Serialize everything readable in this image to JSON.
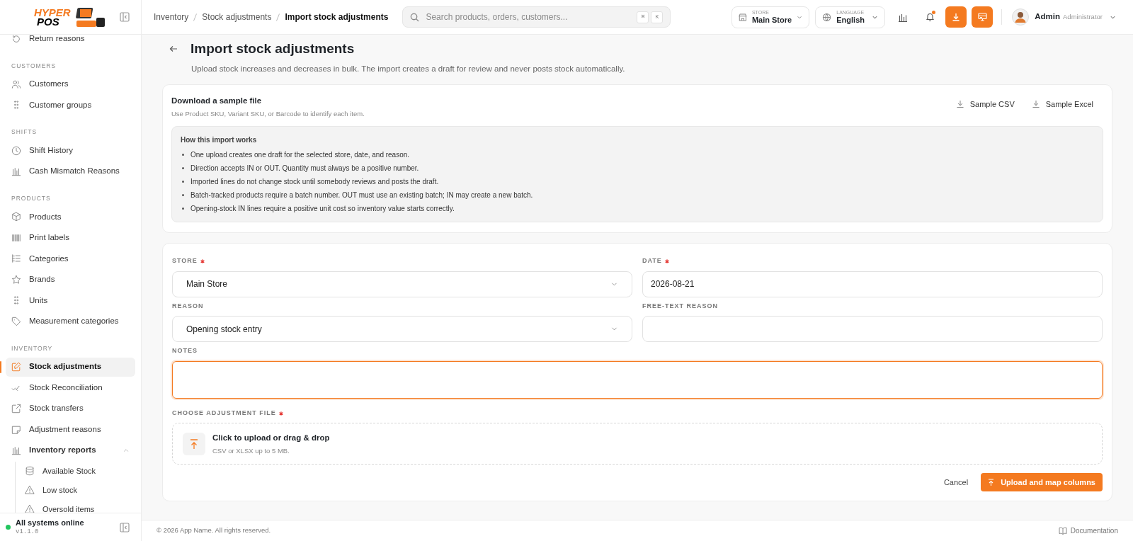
{
  "logo": {
    "line_1": "HYPER",
    "line_2": "POS"
  },
  "breadcrumbs": [
    {
      "label": "Inventory",
      "current": false
    },
    {
      "label": "Stock adjustments",
      "current": false
    },
    {
      "label": "Import stock adjustments",
      "current": true
    }
  ],
  "search": {
    "placeholder": "Search products, orders, customers...",
    "shortcut_keys": [
      "⌘",
      "K"
    ]
  },
  "store_picker": {
    "label": "STORE",
    "value": "Main Store"
  },
  "language_picker": {
    "label": "LANGUAGE",
    "value": "English"
  },
  "notifications": {
    "unread": true
  },
  "user": {
    "name": "Admin",
    "role": "Administrator"
  },
  "sidebar": {
    "sections": [
      {
        "items": [
          {
            "label": "Return reasons",
            "selected": false
          }
        ]
      },
      {
        "heading": "CUSTOMERS",
        "items": [
          {
            "label": "Customers",
            "selected": false
          },
          {
            "label": "Customer groups",
            "selected": false
          }
        ]
      },
      {
        "heading": "SHIFTS",
        "items": [
          {
            "label": "Shift History",
            "selected": false
          },
          {
            "label": "Cash Mismatch Reasons",
            "selected": false
          }
        ]
      },
      {
        "heading": "PRODUCTS",
        "items": [
          {
            "label": "Products",
            "selected": false
          },
          {
            "label": "Print labels",
            "selected": false
          },
          {
            "label": "Categories",
            "selected": false
          },
          {
            "label": "Brands",
            "selected": false
          },
          {
            "label": "Units",
            "selected": false
          },
          {
            "label": "Measurement categories",
            "selected": false
          }
        ]
      },
      {
        "heading": "INVENTORY",
        "items": [
          {
            "label": "Stock adjustments",
            "selected": true
          },
          {
            "label": "Stock Reconciliation",
            "selected": false
          },
          {
            "label": "Stock transfers",
            "selected": false
          },
          {
            "label": "Adjustment reasons",
            "selected": false
          },
          {
            "label": "Inventory reports",
            "selected": false,
            "expanded": true,
            "children": [
              {
                "label": "Available Stock",
                "selected": false
              },
              {
                "label": "Low stock",
                "selected": false
              },
              {
                "label": "Oversold items",
                "selected": false
              }
            ]
          }
        ]
      }
    ],
    "status": {
      "label": "All systems online",
      "online": true,
      "version": "v1.1.0"
    }
  },
  "page": {
    "title": "Import stock adjustments",
    "subtitle": "Upload stock increases and decreases in bulk. The import creates a draft for review and never posts stock automatically."
  },
  "sample_card": {
    "title": "Download a sample file",
    "hint": "Use Product SKU, Variant SKU, or Barcode to identify each item.",
    "downloads": [
      "Sample CSV",
      "Sample Excel"
    ],
    "info": {
      "title": "How this import works",
      "bullets": [
        "One upload creates one draft for the selected store, date, and reason.",
        "Direction accepts IN or OUT. Quantity must always be a positive number.",
        "Imported lines do not change stock until somebody reviews and posts the draft.",
        "Batch-tracked products require a batch number. OUT must use an existing batch; IN may create a new batch.",
        "Opening-stock IN lines require a positive unit cost so inventory value starts correctly."
      ]
    }
  },
  "form": {
    "fields": [
      {
        "label": "STORE",
        "required": true,
        "kind": "select",
        "value": "Main Store",
        "focused": false
      },
      {
        "label": "DATE",
        "required": true,
        "kind": "text",
        "value": "2026-08-21",
        "focused": false
      },
      {
        "label": "REASON",
        "required": false,
        "kind": "select",
        "value": "Opening stock entry",
        "focused": false
      },
      {
        "label": "FREE-TEXT REASON",
        "required": false,
        "kind": "text",
        "focused": false
      },
      {
        "label": "NOTES",
        "required": false,
        "kind": "textarea",
        "focused": true
      }
    ],
    "file": {
      "label": "CHOOSE ADJUSTMENT FILE",
      "required": true,
      "title": "Click to upload or drag & drop",
      "hint": "CSV or XLSX up to 5 MB."
    },
    "cancel": "Cancel",
    "submit": "Upload and map columns"
  },
  "footer": {
    "copyright": "© 2026 App Name. All rights reserved.",
    "documentation": "Documentation"
  }
}
